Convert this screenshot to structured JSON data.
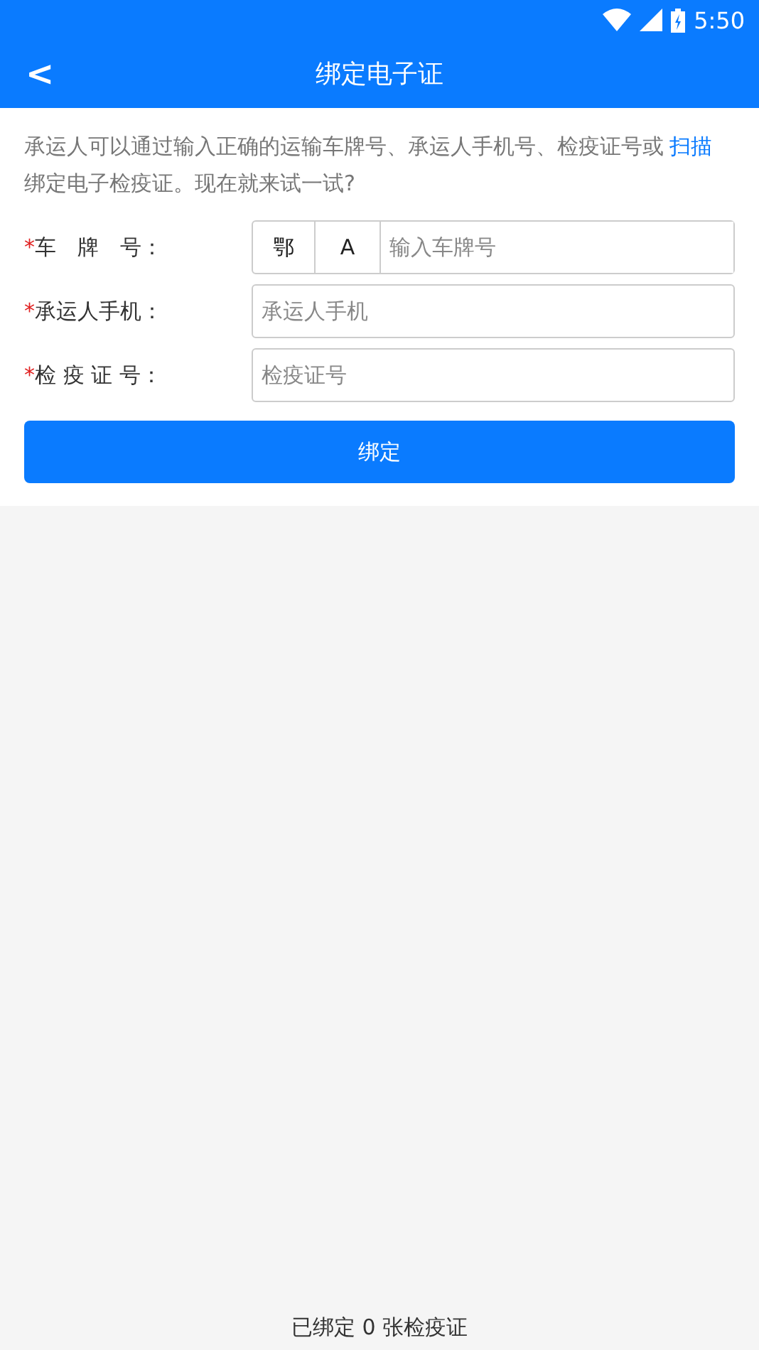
{
  "status_bar": {
    "time": "5:50"
  },
  "header": {
    "back": "<",
    "title": "绑定电子证"
  },
  "intro": {
    "before": "承运人可以通过输入正确的运输车牌号、承运人手机号、检疫证号或",
    "link": "扫描",
    "after": "绑定电子检疫证。现在就来试一试?"
  },
  "form": [
    {
      "kind": "plate",
      "required": "*",
      "label": "车　牌　号：",
      "province": "鄂",
      "letter": "A",
      "placeholder": "输入车牌号"
    },
    {
      "kind": "text",
      "required": "*",
      "label": "承运人手机：",
      "placeholder": "承运人手机"
    },
    {
      "kind": "text",
      "required": "*",
      "label": "检 疫 证 号：",
      "placeholder": "检疫证号"
    }
  ],
  "submit": "绑定",
  "footer": "已绑定 0 张检疫证"
}
